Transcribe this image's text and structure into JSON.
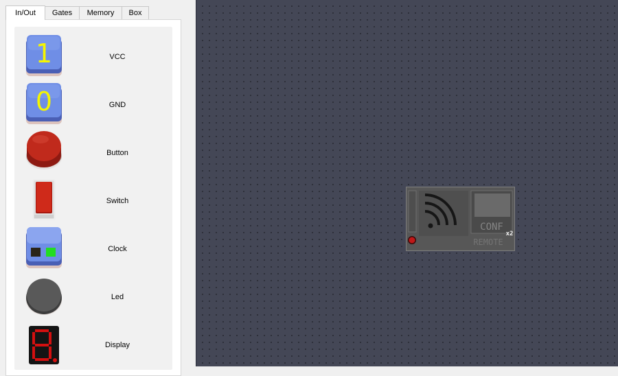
{
  "sidebar": {
    "tabs": [
      {
        "label": "In/Out",
        "active": true
      },
      {
        "label": "Gates",
        "active": false
      },
      {
        "label": "Memory",
        "active": false
      },
      {
        "label": "Box",
        "active": false
      }
    ],
    "components": [
      {
        "label": "VCC",
        "icon": "vcc-icon",
        "glyph": "1"
      },
      {
        "label": "GND",
        "icon": "gnd-icon",
        "glyph": "0"
      },
      {
        "label": "Button",
        "icon": "button-icon"
      },
      {
        "label": "Switch",
        "icon": "switch-icon"
      },
      {
        "label": "Clock",
        "icon": "clock-icon"
      },
      {
        "label": "Led",
        "icon": "led-icon"
      },
      {
        "label": "Display",
        "icon": "display-icon"
      }
    ]
  },
  "canvas": {
    "remote": {
      "conf_label": "CONF",
      "badge": "x2",
      "name_label": "REMOTE"
    }
  },
  "colors": {
    "canvas_bg": "#444756",
    "grid_dot": "#2a2c36",
    "vcc_face": "#6f8ee6",
    "glyph_yellow": "#f5f500",
    "button_red": "#c02a1c",
    "led_gray": "#595959",
    "display_red": "#d41010"
  }
}
